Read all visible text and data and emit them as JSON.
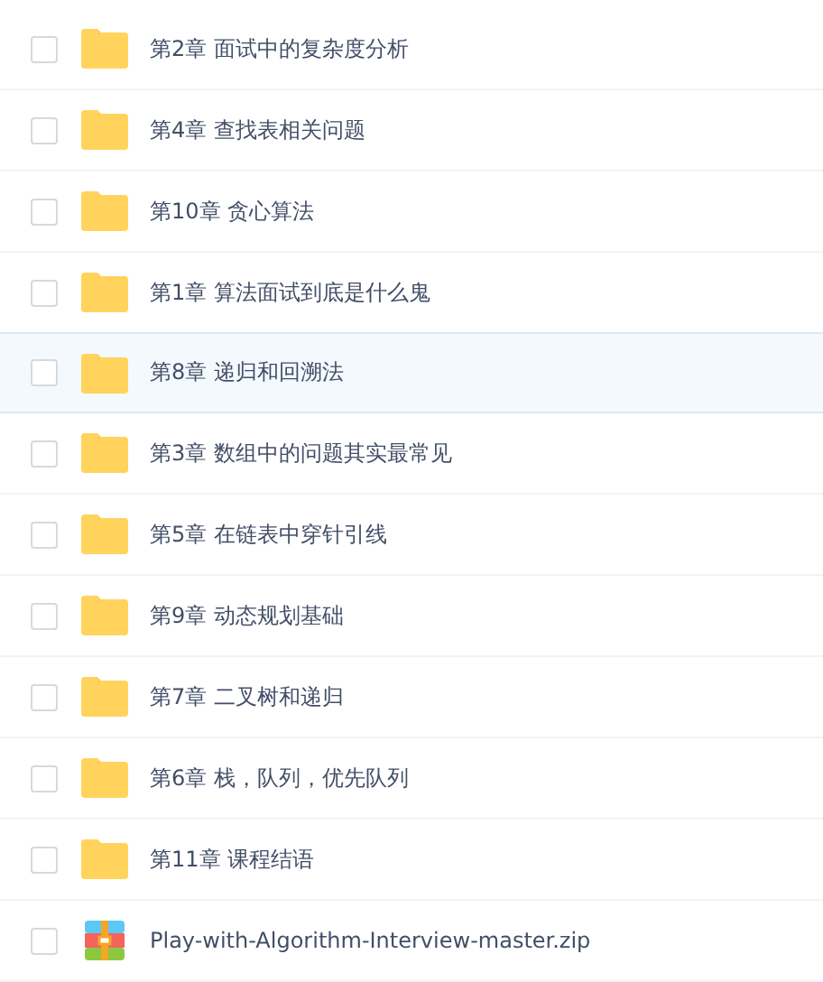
{
  "files": [
    {
      "kind": "folder",
      "name": "第2章 面试中的复杂度分析",
      "checked": false,
      "selected": false
    },
    {
      "kind": "folder",
      "name": "第4章 查找表相关问题",
      "checked": false,
      "selected": false
    },
    {
      "kind": "folder",
      "name": "第10章 贪心算法",
      "checked": false,
      "selected": false
    },
    {
      "kind": "folder",
      "name": "第1章 算法面试到底是什么鬼",
      "checked": false,
      "selected": false
    },
    {
      "kind": "folder",
      "name": "第8章 递归和回溯法",
      "checked": false,
      "selected": true
    },
    {
      "kind": "folder",
      "name": "第3章 数组中的问题其实最常见",
      "checked": false,
      "selected": false
    },
    {
      "kind": "folder",
      "name": "第5章 在链表中穿针引线",
      "checked": false,
      "selected": false
    },
    {
      "kind": "folder",
      "name": "第9章 动态规划基础",
      "checked": false,
      "selected": false
    },
    {
      "kind": "folder",
      "name": "第7章 二叉树和递归",
      "checked": false,
      "selected": false
    },
    {
      "kind": "folder",
      "name": "第6章 栈，队列，优先队列",
      "checked": false,
      "selected": false
    },
    {
      "kind": "folder",
      "name": "第11章 课程结语",
      "checked": false,
      "selected": false
    },
    {
      "kind": "archive",
      "name": "Play-with-Algorithm-Interview-master.zip",
      "checked": false,
      "selected": false
    }
  ]
}
